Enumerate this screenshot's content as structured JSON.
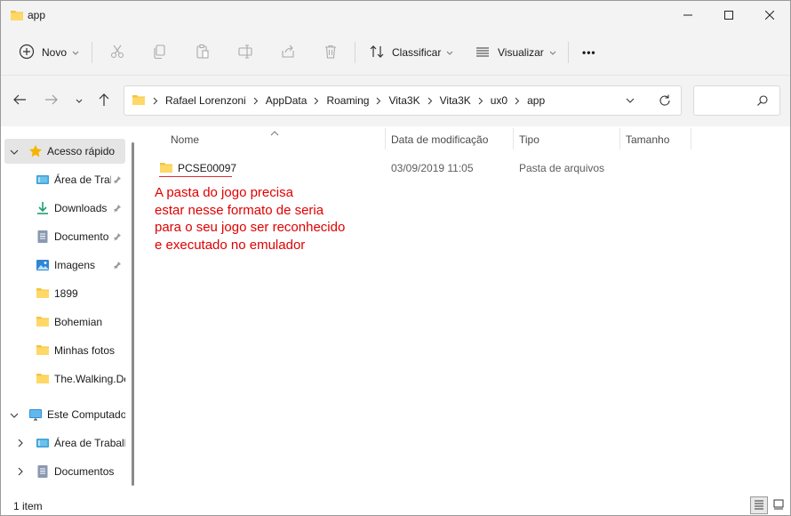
{
  "window": {
    "title": "app"
  },
  "commands": {
    "new_label": "Novo",
    "sort_label": "Classificar",
    "view_label": "Visualizar",
    "more_label": "•••"
  },
  "address": {
    "crumbs": [
      "Rafael Lorenzoni",
      "AppData",
      "Roaming",
      "Vita3K",
      "Vita3K",
      "ux0",
      "app"
    ]
  },
  "sidebar": {
    "items": [
      {
        "label": "Acesso rápido"
      },
      {
        "label": "Área de Trab"
      },
      {
        "label": "Downloads"
      },
      {
        "label": "Documento"
      },
      {
        "label": "Imagens"
      },
      {
        "label": "1899"
      },
      {
        "label": "Bohemian"
      },
      {
        "label": "Minhas fotos"
      },
      {
        "label": "The.Walking.De"
      },
      {
        "label": "Este Computado"
      },
      {
        "label": "Área de Trabalh"
      },
      {
        "label": "Documentos"
      }
    ]
  },
  "columns": {
    "name": "Nome",
    "modified": "Data de modificação",
    "type": "Tipo",
    "size": "Tamanho"
  },
  "files": [
    {
      "name": "PCSE00097",
      "modified": "03/09/2019 11:05",
      "type": "Pasta de arquivos"
    }
  ],
  "annotation": {
    "lines": [
      "A pasta do jogo precisa",
      "estar nesse formato de seria",
      "para o seu jogo ser reconhecido",
      "e executado no emulador"
    ],
    "color": "#e00000"
  },
  "status": {
    "count": "1 item"
  },
  "colors": {
    "folder": "#f5c342",
    "accent": "#0067c0"
  }
}
